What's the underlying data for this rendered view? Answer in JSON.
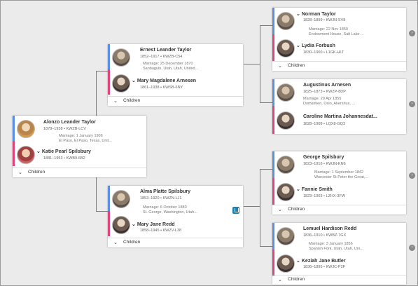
{
  "cards": {
    "alonzo": {
      "father_name": "Alonzo Leander Taylor",
      "father_meta": "1878–1938 • KWZB-LCV",
      "marriage_1": "Marriage: 1 January 1906",
      "marriage_2": "El Paso, El Paso, Texas, Unit...",
      "mother_name": "Katie Pearl Spilsbury",
      "mother_meta": "1881–1953 • KWB9-6B2",
      "children_label": "Children"
    },
    "ernest": {
      "father_name": "Ernest Leander Taylor",
      "father_meta": "1852–1917 • KWZB-C54",
      "marriage_1": "Marriage: 25 December 1870",
      "marriage_2": "Sanbaguin, Utah, Utah, United...",
      "mother_name": "Mary Magdalene Arnesen",
      "mother_meta": "1861–1938 • KWSB-6NY",
      "children_label": "Children"
    },
    "alma": {
      "father_name": "Alma Platte Spilsbury",
      "father_meta": "1853–1920 • KWZN-LJ1",
      "marriage_1": "Marriage: 6 October 1880",
      "marriage_2": "St. George, Washington, Utah...",
      "mother_name": "Mary Jane Redd",
      "mother_meta": "1858–1945 • KWZV-L38",
      "children_label": "Children"
    },
    "norman": {
      "father_name": "Norman Taylor",
      "father_meta": "1828–1899 • KWJN-SV8",
      "marriage_1": "Marriage: 22 Nov 1850",
      "marriage_2": "Endowment House, Salt Lake ...",
      "mother_name": "Lydia Forbush",
      "mother_meta": "1830–1900 • L1GK-HLT",
      "children_label": "Children"
    },
    "augustinus": {
      "father_name": "Augustinus Arnesen",
      "father_meta": "1825–1873 • KWZP-8DP",
      "marriage_1": "Marriage: 29 Apr 1855",
      "marriage_2": "Domkirken, Oslo, Akershus, ...",
      "mother_name": "Caroline Martina Johannesdat...",
      "mother_meta": "1828–1908 • LQX8-GQ3",
      "children_label": "Children"
    },
    "george": {
      "father_name": "George Spilsbury",
      "father_meta": "1823–1916 • KWJN-KN6",
      "marriage_1": "Marriage: 1 September 1842",
      "marriage_2": "Worcester St Peter the Great,...",
      "mother_name": "Fannie Smith",
      "mother_meta": "1823–1903 • LZHX-3FW",
      "children_label": "Children"
    },
    "lemuel": {
      "father_name": "Lemuel Hardison Redd",
      "father_meta": "1836–1910 • KWBZ-7GX",
      "marriage_1": "Marriage: 3 January 1856",
      "marriage_2": "Spanish Fork, Utah, Utah, Uni...",
      "mother_name": "Keziah Jane Butler",
      "mother_meta": "1836–1895 • KWJC-P2F",
      "children_label": "Children"
    }
  },
  "expand_glyph": "›",
  "colors": {
    "father_bar": "#5b8ee6",
    "mother_bar": "#e0447a",
    "temple_badge": "#1f7fb0"
  },
  "icons": {
    "avatar": "portrait-icon",
    "expand": "chevron-down-icon",
    "more": "chevron-right-icon",
    "temple": "temple-icon"
  }
}
